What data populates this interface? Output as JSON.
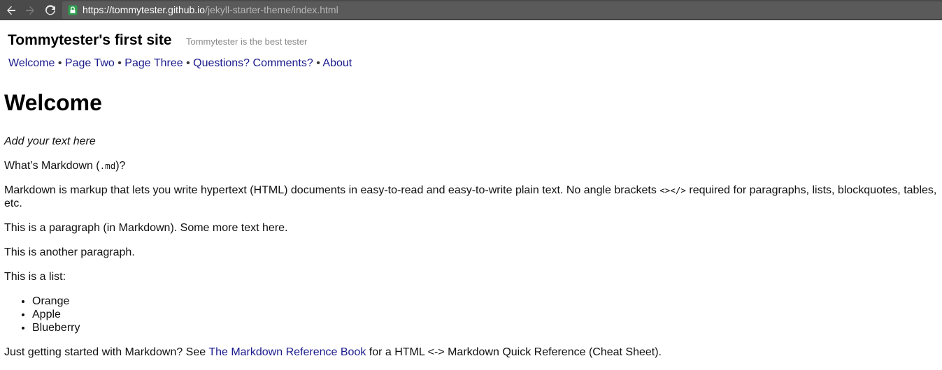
{
  "browser": {
    "url_host": "https://tommytester.github.io",
    "url_path": "/jekyll-starter-theme/index.html",
    "icons": {
      "back": "back-arrow-icon",
      "forward": "forward-arrow-icon",
      "reload": "reload-icon",
      "lock": "lock-icon"
    }
  },
  "header": {
    "site_title": "Tommytester's first site",
    "tagline": "Tommytester is the best tester"
  },
  "nav": {
    "items": [
      {
        "label": "Welcome"
      },
      {
        "label": "Page Two"
      },
      {
        "label": "Page Three"
      },
      {
        "label": "Questions? Comments?"
      },
      {
        "label": "About"
      }
    ],
    "separator": "•"
  },
  "content": {
    "heading": "Welcome",
    "intro": "Add your text here",
    "markdown_question_before": "What’s Markdown (",
    "markdown_question_code": ".md",
    "markdown_question_after": ")?",
    "markdown_desc_before": "Markdown is markup that lets you write hypertext (HTML) documents in easy-to-read and easy-to-write plain text. No angle brackets ",
    "markdown_desc_code": "<></>",
    "markdown_desc_after": " required for paragraphs, lists, blockquotes, tables, etc.",
    "para1": "This is a paragraph (in Markdown). Some more text here.",
    "para2": "This is another paragraph.",
    "list_intro": "This is a list:",
    "list_items": [
      "Orange",
      "Apple",
      "Blueberry"
    ],
    "final_before": "Just getting started with Markdown? See ",
    "final_link": "The Markdown Reference Book",
    "final_after": " for a HTML <-> Markdown Quick Reference (Cheat Sheet)."
  },
  "colors": {
    "link": "#1a1a8c",
    "chrome_bg": "#4a4a4a",
    "lock_green": "#2e9e4f"
  }
}
